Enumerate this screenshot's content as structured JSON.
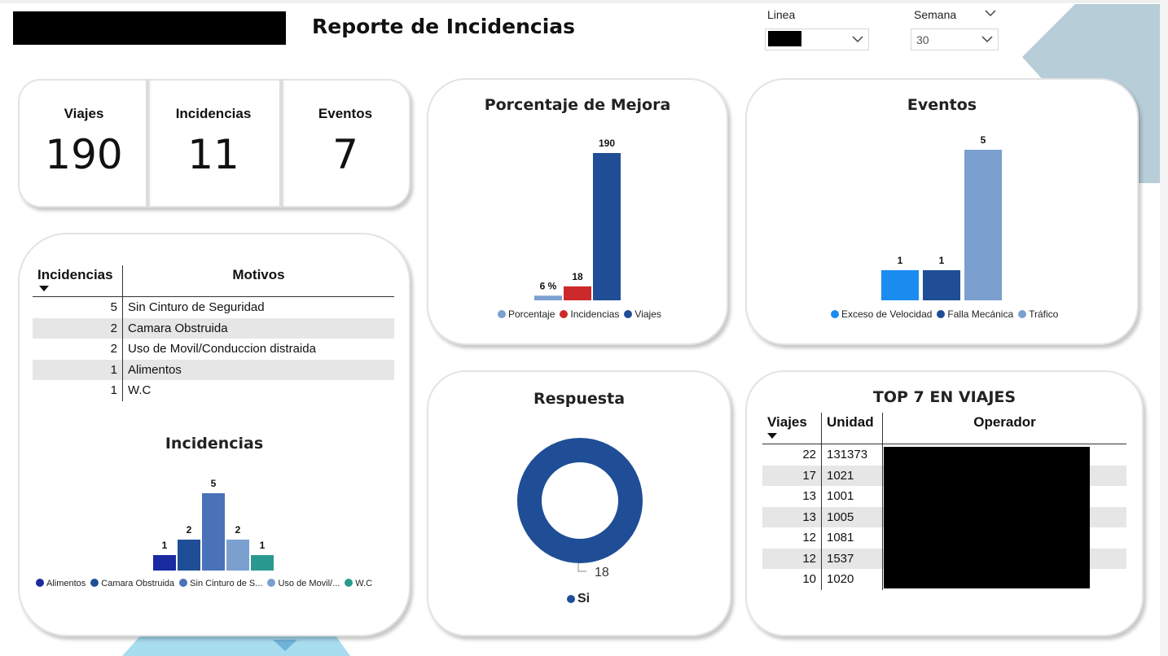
{
  "header": {
    "title": "Reporte de Incidencias"
  },
  "filters": {
    "linea": {
      "label": "Linea",
      "value": ""
    },
    "semana": {
      "label": "Semana",
      "value": "30"
    }
  },
  "kpis": [
    {
      "label": "Viajes",
      "value": "190"
    },
    {
      "label": "Incidencias",
      "value": "11"
    },
    {
      "label": "Eventos",
      "value": "7"
    }
  ],
  "motivos_table": {
    "headers": [
      "Incidencias",
      "Motivos"
    ],
    "rows": [
      {
        "count": "5",
        "motivo": "Sin Cinturo de Seguridad"
      },
      {
        "count": "2",
        "motivo": "Camara Obstruida"
      },
      {
        "count": "2",
        "motivo": "Uso de Movil/Conduccion distraida"
      },
      {
        "count": "1",
        "motivo": "Alimentos"
      },
      {
        "count": "1",
        "motivo": "W.C"
      }
    ]
  },
  "top_viajes": {
    "title": "TOP 7 EN VIAJES",
    "headers": [
      "Viajes",
      "Unidad",
      "Operador"
    ],
    "rows": [
      {
        "viajes": "22",
        "unidad": "131373"
      },
      {
        "viajes": "17",
        "unidad": "1021"
      },
      {
        "viajes": "13",
        "unidad": "1001"
      },
      {
        "viajes": "13",
        "unidad": "1005"
      },
      {
        "viajes": "12",
        "unidad": "1081"
      },
      {
        "viajes": "12",
        "unidad": "1537"
      },
      {
        "viajes": "10",
        "unidad": "1020"
      }
    ]
  },
  "colors": {
    "accent": "#1f4e96",
    "red": "#cc2a2a",
    "light": "#7ba0d0",
    "bright": "#1a8cf0",
    "navy": "#1a2aa0",
    "mid": "#4a72b8",
    "teal": "#2a9a90",
    "deco": "#b7cdd8",
    "deco_light": "#a8dcef"
  },
  "chart_data": [
    {
      "id": "mejora",
      "type": "bar",
      "title": "Porcentaje de Mejora",
      "categories": [
        "Porcentaje",
        "Incidencias",
        "Viajes"
      ],
      "values": [
        6,
        18,
        190
      ],
      "data_labels": [
        "6 %",
        "18",
        "190"
      ],
      "colors": [
        "#7ba0d0",
        "#cc2a2a",
        "#1f4e96"
      ],
      "ylim": [
        0,
        190
      ],
      "legend": "bottom"
    },
    {
      "id": "eventos",
      "type": "bar",
      "title": "Eventos",
      "categories": [
        "Exceso de Velocidad",
        "Falla Mecánica",
        "Tráfico"
      ],
      "values": [
        1,
        1,
        5
      ],
      "colors": [
        "#1a8cf0",
        "#1f4e96",
        "#7ba0d0"
      ],
      "ylim": [
        0,
        5
      ],
      "legend": "bottom"
    },
    {
      "id": "incidencias",
      "type": "bar",
      "title": "Incidencias",
      "categories": [
        "Alimentos",
        "Camara Obstruida",
        "Sin Cinturo de S...",
        "Uso de Movil/...",
        "W.C"
      ],
      "values": [
        1,
        2,
        5,
        2,
        1
      ],
      "colors": [
        "#1a2aa0",
        "#1f4e96",
        "#4a72b8",
        "#7ba0d0",
        "#2a9a90"
      ],
      "ylim": [
        0,
        5
      ],
      "legend": "bottom"
    },
    {
      "id": "respuesta",
      "type": "pie",
      "title": "Respuesta",
      "categories": [
        "Si"
      ],
      "values": [
        18
      ],
      "colors": [
        "#1f4e96"
      ],
      "legend": "bottom"
    }
  ]
}
